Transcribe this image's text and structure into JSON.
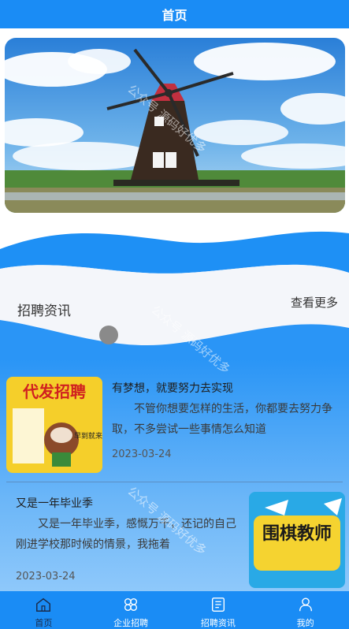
{
  "nav": {
    "title": "首页"
  },
  "banner": {
    "image": "windmill-landscape"
  },
  "section": {
    "title": "招聘资讯",
    "more_label": "查看更多"
  },
  "news": [
    {
      "title": "有梦想，就要努力去实现",
      "desc": "不管你想要怎样的生活，你都要去努力争取，不多尝试一些事情怎么知道",
      "date": "2023-03-24",
      "thumb_text": "代发招聘",
      "thumb_sub": "早到就来"
    },
    {
      "title": "又是一年毕业季",
      "desc": "又是一年毕业季，感慨万千，还记的自己刚进学校那时候的情景，我拖着",
      "date": "2023-03-24",
      "thumb_text": "围棋教师"
    }
  ],
  "tabs": [
    {
      "label": "首页",
      "icon": "home-icon",
      "active": true
    },
    {
      "label": "企业招聘",
      "icon": "grid-icon",
      "active": false
    },
    {
      "label": "招聘资讯",
      "icon": "news-icon",
      "active": false
    },
    {
      "label": "我的",
      "icon": "user-icon",
      "active": false
    }
  ],
  "watermark": "公众号 源码好优多",
  "colors": {
    "primary": "#1a8cf5",
    "wave": "#1e90f5"
  }
}
